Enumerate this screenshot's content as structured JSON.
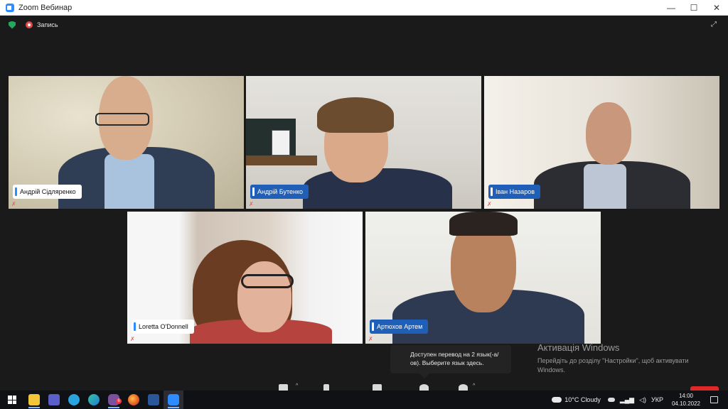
{
  "window": {
    "title": "Zoom Вебинар",
    "minimize": "—",
    "maximize": "☐",
    "close": "✕"
  },
  "topbar": {
    "recording_label": "Запись",
    "fullscreen_glyph": "⤢"
  },
  "participants": [
    {
      "name": "Андрій Сідляренко",
      "tag_style": "light"
    },
    {
      "name": "Андрій Бутенко",
      "tag_style": "blue"
    },
    {
      "name": "Іван Назаров",
      "tag_style": "blue"
    },
    {
      "name": "Loretta O'Donnell",
      "tag_style": "light"
    },
    {
      "name": "Артюхов Артем",
      "tag_style": "blue"
    }
  ],
  "mic_glyph": "✗",
  "tooltip": {
    "text": "Доступен перевод на 2 язык(-а/ов). Выберите язык здесь."
  },
  "activation": {
    "title": "Активація Windows",
    "text": "Перейдіть до розділу \"Настройки\", щоб активувати Windows."
  },
  "controls": {
    "caret": "^"
  },
  "taskbar": {
    "start_icon": "windows-logo",
    "apps": [
      "file-explorer",
      "teams",
      "telegram",
      "edge",
      "viber",
      "firefox",
      "word",
      "zoom"
    ],
    "viber_badge": "6",
    "weather": "10°C  Cloudy",
    "language": "УКР",
    "time": "14:00",
    "date": "04.10.2022"
  },
  "colors": {
    "accent": "#2d8cff",
    "name_tag_blue": "#1f5fb8",
    "end_red": "#e02828"
  }
}
